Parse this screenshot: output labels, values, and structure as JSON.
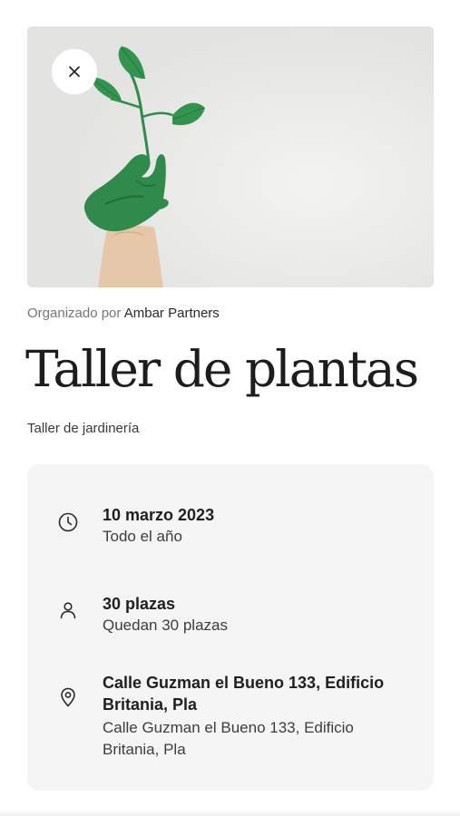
{
  "header": {
    "close_label": "Cerrar"
  },
  "hero": {
    "image_icon": "plant-in-hand-image"
  },
  "event": {
    "organizer_prefix": "Organizado por",
    "organizer_name": "Ambar Partners",
    "title": "Taller de plantas",
    "subtitle": "Taller de jardinería"
  },
  "details": {
    "date": {
      "icon": "clock-icon",
      "title": "10 marzo 2023",
      "sub": "Todo el año"
    },
    "capacity": {
      "icon": "person-icon",
      "title": "30 plazas",
      "sub": "Quedan 30 plazas"
    },
    "location": {
      "icon": "location-pin-icon",
      "title": "Calle Guzman el Bueno 133, Edificio Britania, Pla",
      "sub": "Calle Guzman el Bueno 133, Edificio Britania, Pla"
    }
  },
  "colors": {
    "card_bg": "#f5f5f5",
    "leaf_green": "#2e8b4e",
    "text_dark": "#1f1f1f",
    "text_muted": "#767676"
  }
}
